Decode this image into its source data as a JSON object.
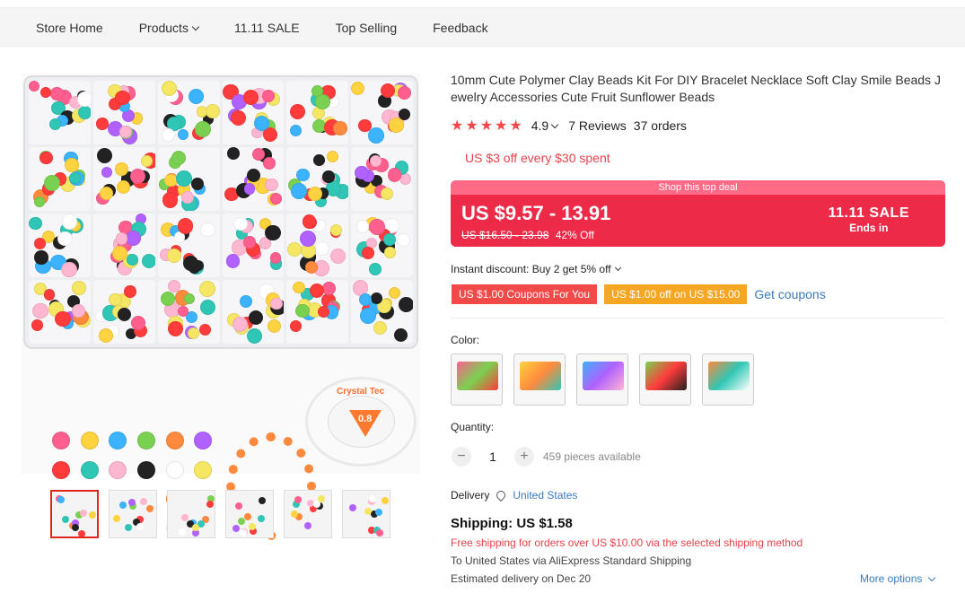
{
  "nav": {
    "items": [
      "Store Home",
      "Products",
      "11.11 SALE",
      "Top Selling",
      "Feedback"
    ]
  },
  "product": {
    "title": "10mm Cute Polymer Clay Beads Kit For DIY Bracelet Necklace Soft Clay Smile Beads Jewelry Accessories Cute Fruit Sunflower Beads",
    "stars": "★★★★★",
    "rating": "4.9",
    "reviews": "7 Reviews",
    "orders": "37 orders",
    "promo": "US $3 off every $30 spent",
    "spool_label": "Crystal Tec",
    "spool_value": "0.8"
  },
  "deal": {
    "banner": "Shop this top deal",
    "price": "US $9.57 - 13.91",
    "original": "US $16.50 - 23.98",
    "discount": "42% Off",
    "sale_title": "11.11 SALE",
    "sale_sub": "Ends in"
  },
  "discounts": {
    "instant": "Instant discount: Buy 2 get 5% off",
    "coupon1": "US $1.00 Coupons For You",
    "coupon2": "US $1.00 off on US $15.00",
    "get_coupons": "Get coupons"
  },
  "options": {
    "color_label": "Color:",
    "quantity_label": "Quantity:",
    "quantity": "1",
    "minus": "−",
    "plus": "+",
    "available": "459 pieces available"
  },
  "shipping": {
    "delivery_label": "Delivery",
    "country": "United States",
    "cost": "Shipping: US $1.58",
    "free": "Free shipping for orders over US $10.00 via the selected shipping method",
    "via": "To United States via AliExpress Standard Shipping",
    "estimated": "Estimated delivery on Dec 20",
    "more_options": "More options"
  },
  "colors": {
    "accent": "#ed2b48",
    "link": "#3a7bbf",
    "orange": "#f5a623",
    "star": "#f5474b"
  }
}
